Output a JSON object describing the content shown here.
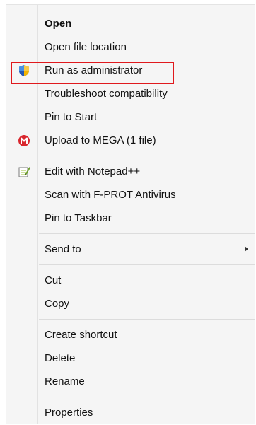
{
  "menu": {
    "items": [
      {
        "label": "Open",
        "icon": null
      },
      {
        "label": "Open file location",
        "icon": null
      },
      {
        "label": "Run as administrator",
        "icon": "uac-shield-icon",
        "highlighted": true
      },
      {
        "label": "Troubleshoot compatibility",
        "icon": null
      },
      {
        "label": "Pin to Start",
        "icon": null
      },
      {
        "label": "Upload to MEGA (1 file)",
        "icon": "mega-icon"
      },
      {
        "label": "Edit with Notepad++",
        "icon": "notepadpp-icon"
      },
      {
        "label": "Scan with F-PROT Antivirus",
        "icon": null
      },
      {
        "label": "Pin to Taskbar",
        "icon": null
      },
      {
        "label": "Send to",
        "icon": null,
        "submenu": true
      },
      {
        "label": "Cut",
        "icon": null
      },
      {
        "label": "Copy",
        "icon": null
      },
      {
        "label": "Create shortcut",
        "icon": null
      },
      {
        "label": "Delete",
        "icon": null
      },
      {
        "label": "Rename",
        "icon": null
      },
      {
        "label": "Properties",
        "icon": null
      }
    ]
  },
  "colors": {
    "highlight_border": "#e0191d",
    "menu_background": "#f5f5f5",
    "mega_red": "#d9272e"
  }
}
